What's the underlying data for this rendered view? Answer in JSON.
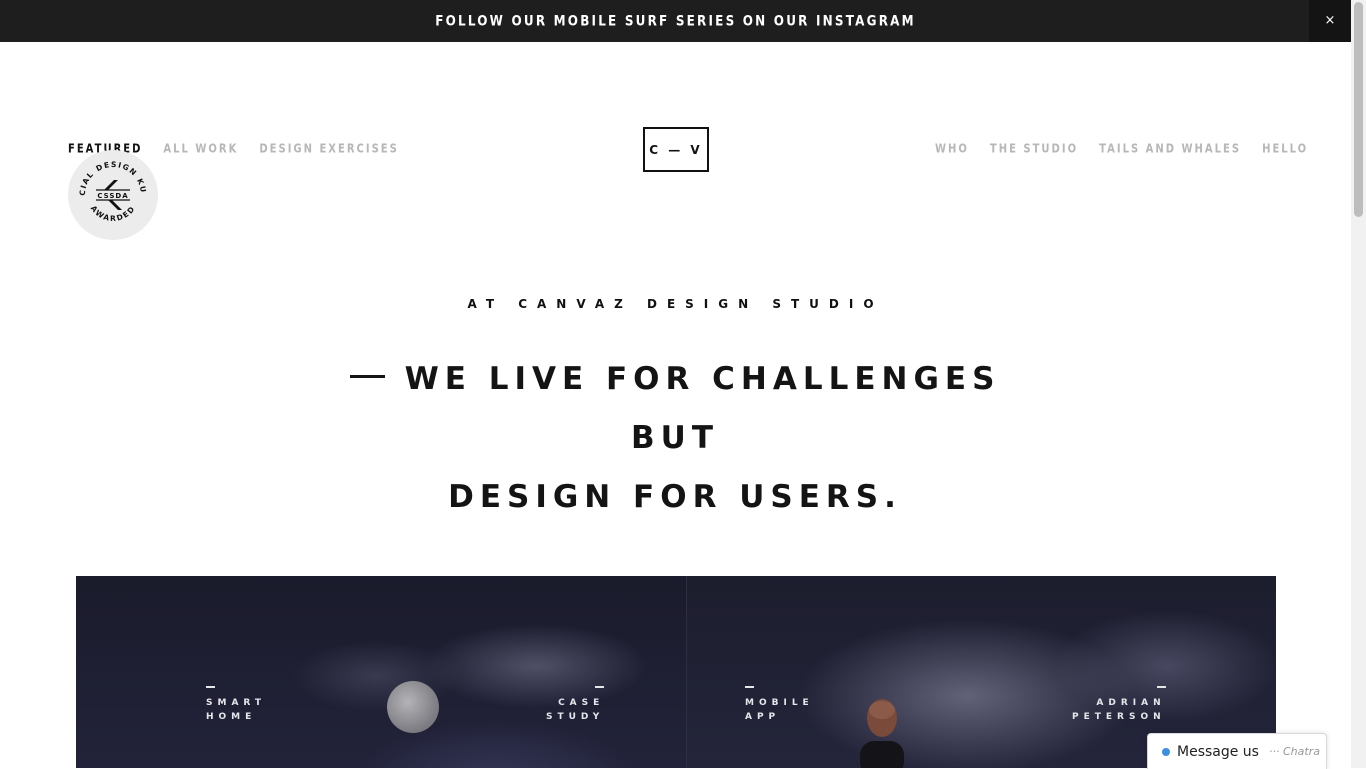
{
  "banner": {
    "text": "FOLLOW OUR MOBILE SURF SERIES ON OUR INSTAGRAM",
    "close": "×"
  },
  "nav_left": [
    {
      "label": "FEATURED",
      "active": true
    },
    {
      "label": "ALL WORK",
      "active": false
    },
    {
      "label": "DESIGN EXERCISES",
      "active": false
    }
  ],
  "logo": "C — V",
  "nav_right": [
    {
      "label": "WHO"
    },
    {
      "label": "THE STUDIO"
    },
    {
      "label": "TAILS AND WHALES"
    },
    {
      "label": "HELLO"
    }
  ],
  "badge": {
    "top_text": "SPECIAL DESIGN KUDOS",
    "center_text": "CSSDA",
    "bottom_text": "AWARDED"
  },
  "hero": {
    "eyebrow": "AT CANVAZ DESIGN STUDIO",
    "headline_line1": "WE LIVE FOR CHALLENGES BUT",
    "headline_line2": "DESIGN FOR USERS."
  },
  "showcase": {
    "left": {
      "tag_left": "SMART\nHOME",
      "tag_right": "CASE\nSTUDY"
    },
    "right": {
      "tag_left": "MOBILE\nAPP",
      "tag_right": "ADRIAN\nPETERSON"
    }
  },
  "chat": {
    "label": "Message us",
    "brand": "··· Chatra"
  },
  "colors": {
    "banner_bg": "#1e1e1e",
    "nav_inactive": "#b7b7b7",
    "showcase_bg": "#1b1c2c",
    "chat_dot": "#3b8fe0"
  }
}
